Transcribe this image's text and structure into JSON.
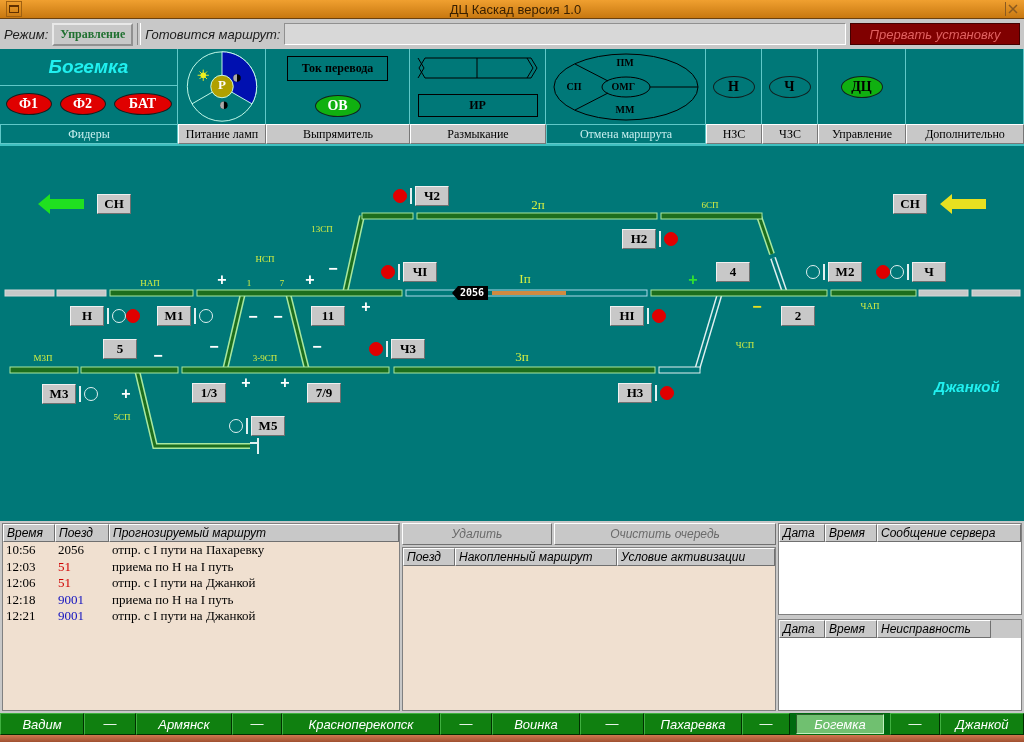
{
  "window": {
    "title": "ДЦ Каскад версия 1.0"
  },
  "toolbar": {
    "mode_label": "Режим:",
    "mode_value": "Управление",
    "route_label": "Готовится маршрут:",
    "abort_button": "Прервать установку"
  },
  "panel": {
    "station": "Богемка",
    "feeders": [
      {
        "label": "Ф1",
        "color": "#e00000"
      },
      {
        "label": "Ф2",
        "color": "#e00000"
      },
      {
        "label": "БАТ",
        "color": "#e00000"
      }
    ],
    "lamp_power": {
      "center": "Р"
    },
    "rectifier": {
      "current": "Ток перевода",
      "indicator": {
        "label": "ОВ",
        "color": "#10b010"
      }
    },
    "release": {
      "box": "ИР"
    },
    "cancel": {
      "top": "ПМ",
      "left": "СП",
      "center": "ОМГ",
      "bottom": "ММ"
    },
    "zones": [
      {
        "label": "Н",
        "color": "#007878"
      },
      {
        "label": "Ч",
        "color": "#007878"
      },
      {
        "label": "ДЦ",
        "color": "#10b010"
      }
    ],
    "tabs": [
      {
        "label": "Фидеры",
        "selected": true
      },
      {
        "label": "Питание ламп",
        "selected": false
      },
      {
        "label": "Выпрямитель",
        "selected": false
      },
      {
        "label": "Размыкание",
        "selected": false
      },
      {
        "label": "Отмена маршрута",
        "selected": true
      },
      {
        "label": "НЗС",
        "selected": false
      },
      {
        "label": "ЧЗС",
        "selected": false
      },
      {
        "label": "Управление",
        "selected": false
      },
      {
        "label": "Дополнительно",
        "selected": false
      }
    ]
  },
  "schematic": {
    "approach": [
      {
        "label": "СН",
        "color": "#20e020"
      },
      {
        "label": "СН",
        "color": "#e8e020"
      }
    ],
    "signals": [
      {
        "label": "Ч2",
        "lamps": [
          true
        ]
      },
      {
        "label": "ЧI",
        "lamps": [
          true
        ]
      },
      {
        "label": "Ч3",
        "lamps": [
          true
        ]
      },
      {
        "label": "Н",
        "lamps": [
          false,
          true
        ]
      },
      {
        "label": "М1",
        "lamps": [
          false
        ]
      },
      {
        "label": "М5",
        "lamps": [
          false
        ]
      },
      {
        "label": "М3",
        "lamps": [
          false
        ]
      },
      {
        "label": "Н2",
        "lamps": [
          true
        ]
      },
      {
        "label": "НI",
        "lamps": [
          true
        ]
      },
      {
        "label": "Н3",
        "lamps": [
          true
        ]
      },
      {
        "label": "М2",
        "lamps": [
          false
        ]
      },
      {
        "label": "Ч",
        "lamps": [
          true,
          false
        ]
      }
    ],
    "switches": [
      "11",
      "5",
      "1/3",
      "7/9",
      "4",
      "2"
    ],
    "sections": [
      "НАП",
      "НСП",
      "13СП",
      "1",
      "7",
      "2п",
      "6СП",
      "Iп",
      "3п",
      "ЧСП",
      "ЧАП",
      "М3П",
      "3-9СП",
      "5СП"
    ],
    "marks": [
      {
        "text": "+",
        "color": "#ffffff"
      },
      {
        "text": "+",
        "color": "#ffffff"
      },
      {
        "text": "−",
        "color": "#ffffff"
      },
      {
        "text": "−",
        "color": "#ffffff"
      },
      {
        "text": "−",
        "color": "#ffffff"
      },
      {
        "text": "+",
        "color": "#ffffff"
      },
      {
        "text": "−",
        "color": "#ffffff"
      },
      {
        "text": "−",
        "color": "#ffffff"
      },
      {
        "text": "−",
        "color": "#ffffff"
      },
      {
        "text": "+",
        "color": "#ffffff"
      },
      {
        "text": "+",
        "color": "#ffffff"
      },
      {
        "text": "+",
        "color": "#ffffff"
      },
      {
        "text": "+",
        "color": "#30e030"
      },
      {
        "text": "−",
        "color": "#e8e020"
      }
    ],
    "train": "2056",
    "neighbour": "Джанкой"
  },
  "forecast": {
    "columns": [
      "Время",
      "Поезд",
      "Прогнозируемый маршрут"
    ],
    "rows": [
      {
        "time": "10:56",
        "train": "2056",
        "color": "#000000",
        "route": "отпр. с I пути на Пахаревку"
      },
      {
        "time": "12:03",
        "train": "51",
        "color": "#d00000",
        "route": "приема по Н на I путь"
      },
      {
        "time": "12:06",
        "train": "51",
        "color": "#d00000",
        "route": "отпр. с I пути на Джанкой"
      },
      {
        "time": "12:18",
        "train": "9001",
        "color": "#1010c0",
        "route": "приема по Н на I путь"
      },
      {
        "time": "12:21",
        "train": "9001",
        "color": "#1010c0",
        "route": "отпр. с I пути на Джанкой"
      }
    ]
  },
  "queue": {
    "buttons": [
      {
        "label": "Удалить",
        "disabled": true
      },
      {
        "label": "Очистить очередь",
        "disabled": true
      }
    ],
    "columns": [
      "Поезд",
      "Накопленный маршрут",
      "Условие активизации"
    ]
  },
  "messages": {
    "columns": [
      "Дата",
      "Время",
      "Сообщение сервера"
    ]
  },
  "faults": {
    "columns": [
      "Дата",
      "Время",
      "Неисправность"
    ]
  },
  "stations": [
    {
      "label": "Вадим",
      "kind": "station",
      "selected": false
    },
    {
      "label": "—",
      "kind": "separator",
      "selected": false
    },
    {
      "label": "Армянск",
      "kind": "station",
      "selected": false
    },
    {
      "label": "—",
      "kind": "separator",
      "selected": false
    },
    {
      "label": "Красноперекопск",
      "kind": "station",
      "selected": false
    },
    {
      "label": "—",
      "kind": "separator",
      "selected": false
    },
    {
      "label": "Воинка",
      "kind": "station",
      "selected": false
    },
    {
      "label": "—",
      "kind": "separator",
      "selected": false
    },
    {
      "label": "Пахаревка",
      "kind": "station",
      "selected": false
    },
    {
      "label": "—",
      "kind": "separator",
      "selected": false
    },
    {
      "label": "Богемка",
      "kind": "station",
      "selected": true
    },
    {
      "label": "—",
      "kind": "separator",
      "selected": false
    },
    {
      "label": "Джанкой",
      "kind": "station",
      "selected": false
    }
  ]
}
